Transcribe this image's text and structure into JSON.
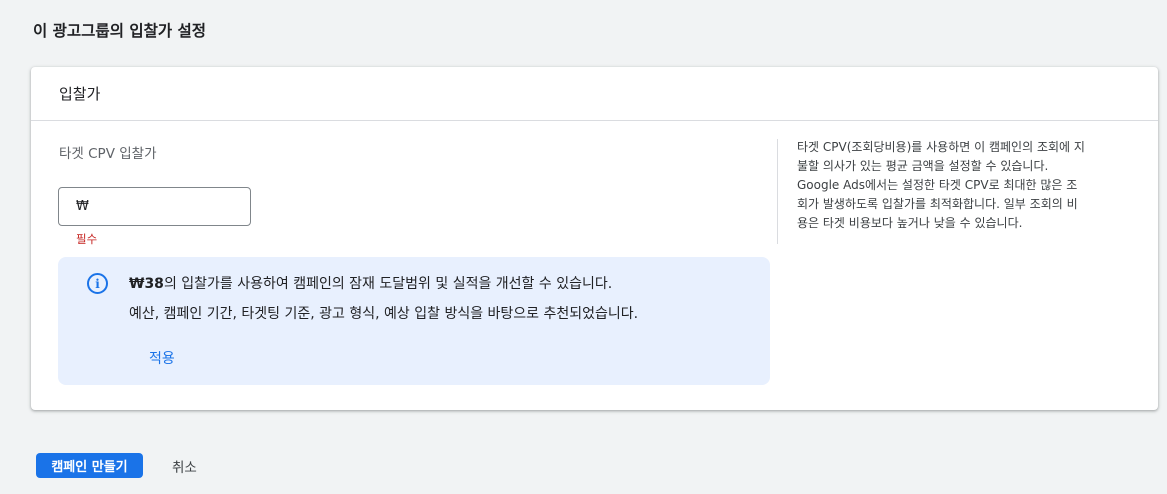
{
  "section": {
    "title": "이 광고그룹의 입찰가 설정"
  },
  "card": {
    "header_title": "입찰가",
    "field_label": "타겟 CPV 입찰가",
    "input": {
      "prefix": "₩",
      "value": ""
    },
    "required_text": "필수",
    "info": {
      "amount": "₩38",
      "line1_rest": "의 입찰가를 사용하여 캠페인의 잠재 도달범위 및 실적을 개선할 수 있습니다.",
      "line2": "예산, 캠페인 기간, 타겟팅 기준, 광고 형식, 예상 입찰 방식을 바탕으로 추천되었습니다.",
      "apply_label": "적용"
    },
    "help_text": "타겟 CPV(조회당비용)를 사용하면 이 캠페인의 조회에 지불할 의사가 있는 평균 금액을 설정할 수 있습니다. Google Ads에서는 설정한 타겟 CPV로 최대한 많은 조회가 발생하도록 입찰가를 최적화합니다. 일부 조회의 비용은 타겟 비용보다 높거나 낮을 수 있습니다."
  },
  "footer": {
    "create_label": "캠페인 만들기",
    "cancel_label": "취소"
  },
  "colors": {
    "accent": "#1a73e8",
    "required": "#c5221f",
    "info_bg": "#e8f0fe",
    "page_bg": "#f1f3f4"
  }
}
